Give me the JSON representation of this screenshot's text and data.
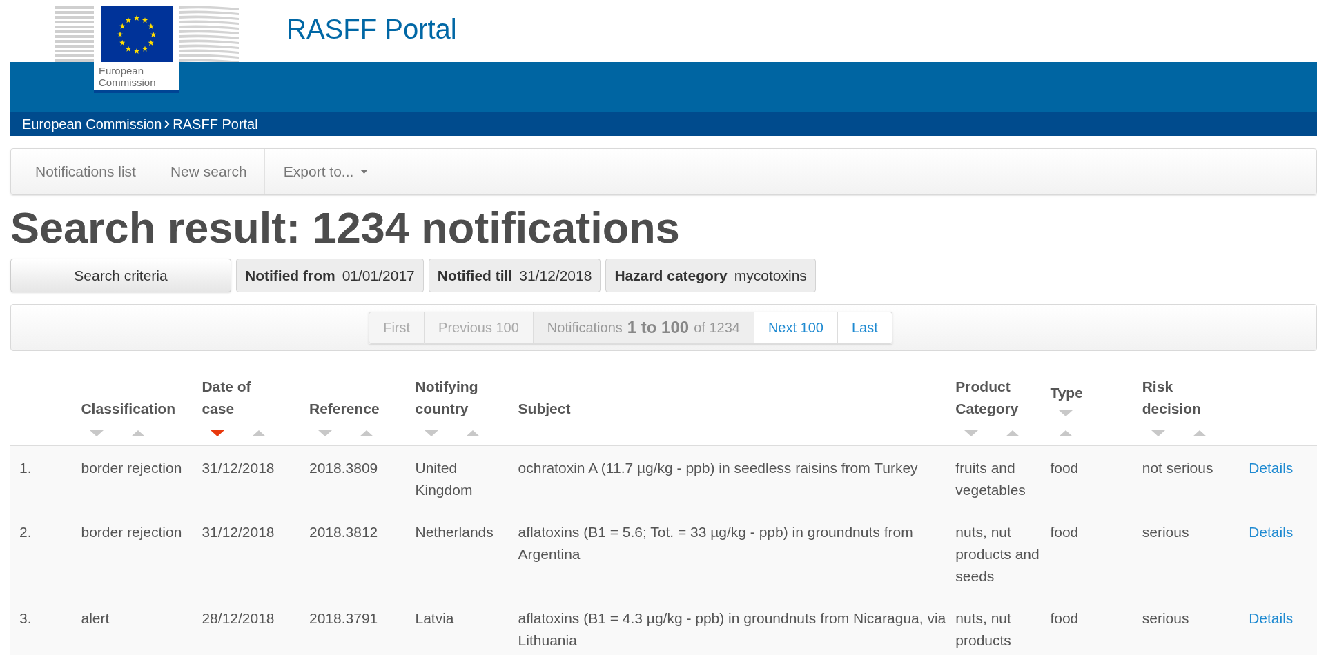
{
  "logo": {
    "caption": "European Commission"
  },
  "site_title": "RASFF Portal",
  "breadcrumb": [
    {
      "label": "European Commission"
    },
    {
      "label": "RASFF Portal"
    }
  ],
  "nav": {
    "items": [
      {
        "label": "Notifications list"
      },
      {
        "label": "New search"
      }
    ],
    "dropdown": {
      "label": "Export to..."
    }
  },
  "heading": "Search result: 1234 notifications",
  "search_criteria_button": "Search criteria",
  "filters": [
    {
      "name": "Notified from",
      "value": "01/01/2017"
    },
    {
      "name": "Notified till",
      "value": "31/12/2018"
    },
    {
      "name": "Hazard category",
      "value": "mycotoxins"
    }
  ],
  "pagination": [
    {
      "kind": "link",
      "label": "First",
      "disabled": true
    },
    {
      "kind": "link",
      "label": "Previous 100",
      "disabled": true
    },
    {
      "kind": "status",
      "label": "Notifications **1 to 100** of 1234"
    },
    {
      "kind": "link",
      "label": "Next 100",
      "disabled": false
    },
    {
      "kind": "link",
      "label": "Last",
      "disabled": false
    }
  ],
  "table": {
    "columns": [
      {
        "label": "Classification",
        "kind": "sortable",
        "sorted_descending": false
      },
      {
        "label": "Date of case",
        "kind": "sortable",
        "sorted_descending": true
      },
      {
        "label": "Reference",
        "kind": "sortable",
        "sorted_descending": false
      },
      {
        "label": "Notifying country",
        "kind": "sortable",
        "sorted_descending": false
      },
      {
        "label": "Subject",
        "kind": "plain"
      },
      {
        "label": "Product Category",
        "kind": "sortable",
        "sorted_descending": false
      },
      {
        "label": "Type",
        "kind": "stacked",
        "sorted_descending": false
      },
      {
        "label": "Risk decision",
        "kind": "sortable",
        "sorted_descending": false
      }
    ],
    "rows": [
      {
        "number": "1.",
        "cells": [
          "border rejection",
          "31/12/2018",
          "2018.3809",
          "United Kingdom",
          "ochratoxin A (11.7 µg/kg - ppb) in seedless raisins from Turkey",
          "fruits and vegetables",
          "food",
          "not serious"
        ],
        "link": "Details"
      },
      {
        "number": "2.",
        "cells": [
          "border rejection",
          "31/12/2018",
          "2018.3812",
          "Netherlands",
          "aflatoxins (B1 = 5.6; Tot. = 33 µg/kg - ppb) in groundnuts from Argentina",
          "nuts, nut products and seeds",
          "food",
          "serious"
        ],
        "link": "Details"
      },
      {
        "number": "3.",
        "cells": [
          "alert",
          "28/12/2018",
          "2018.3791",
          "Latvia",
          "aflatoxins (B1 = 4.3 µg/kg - ppb) in groundnuts from Nicaragua, via Lithuania",
          "nuts, nut products",
          "food",
          "serious"
        ],
        "link": "Details"
      }
    ]
  }
}
